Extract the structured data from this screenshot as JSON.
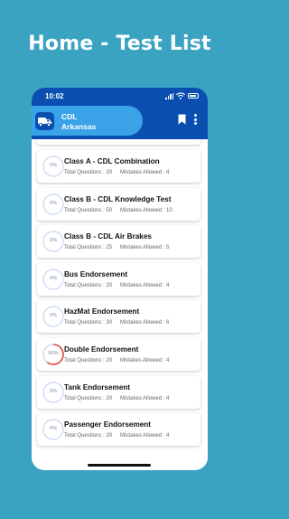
{
  "headline": "Home - Test List",
  "status_bar": {
    "time": "10:02"
  },
  "app_bar": {
    "brand_line1": "CDL",
    "brand_line2": "Arkansas"
  },
  "tests": [
    {
      "title": "Class A - CDL Combination",
      "questions_label": "Total Questions : 20",
      "mistakes_label": "Mistakes Allowed : 4",
      "progress_label": "0%",
      "progress": 0
    },
    {
      "title": "Class B - CDL Knowledge Test",
      "questions_label": "Total Questions : 50",
      "mistakes_label": "Mistakes Allowed : 10",
      "progress_label": "0%",
      "progress": 0
    },
    {
      "title": "Class B - CDL Air Brakes",
      "questions_label": "Total Questions : 25",
      "mistakes_label": "Mistakes Allowed : 5",
      "progress_label": "0%",
      "progress": 0
    },
    {
      "title": "Bus Endorsement",
      "questions_label": "Total Questions : 20",
      "mistakes_label": "Mistakes Allowed : 4",
      "progress_label": "0%",
      "progress": 0
    },
    {
      "title": "HazMat Endorsement",
      "questions_label": "Total Questions : 30",
      "mistakes_label": "Mistakes Allowed : 6",
      "progress_label": "0%",
      "progress": 0
    },
    {
      "title": "Double Endorsement",
      "questions_label": "Total Questions : 20",
      "mistakes_label": "Mistakes Allowed : 4",
      "progress_label": "60%",
      "progress": 60
    },
    {
      "title": "Tank Endorsement",
      "questions_label": "Total Questions : 20",
      "mistakes_label": "Mistakes Allowed : 4",
      "progress_label": "0%",
      "progress": 0
    },
    {
      "title": "Passenger Endorsement",
      "questions_label": "Total Questions : 20",
      "mistakes_label": "Mistakes Allowed : 4",
      "progress_label": "0%",
      "progress": 0
    }
  ],
  "colors": {
    "background": "#3aa3c2",
    "app_bar": "#0a4fb0",
    "brand_pill": "#3aa3e8",
    "ring_track": "#c9d6f2",
    "ring_progress": "#e0443a"
  },
  "icons": {
    "truck": "truck-icon",
    "bookmark": "bookmark-icon",
    "menu": "kebab-menu-icon",
    "wifi": "wifi-icon",
    "signal": "signal-icon",
    "battery": "battery-icon"
  }
}
